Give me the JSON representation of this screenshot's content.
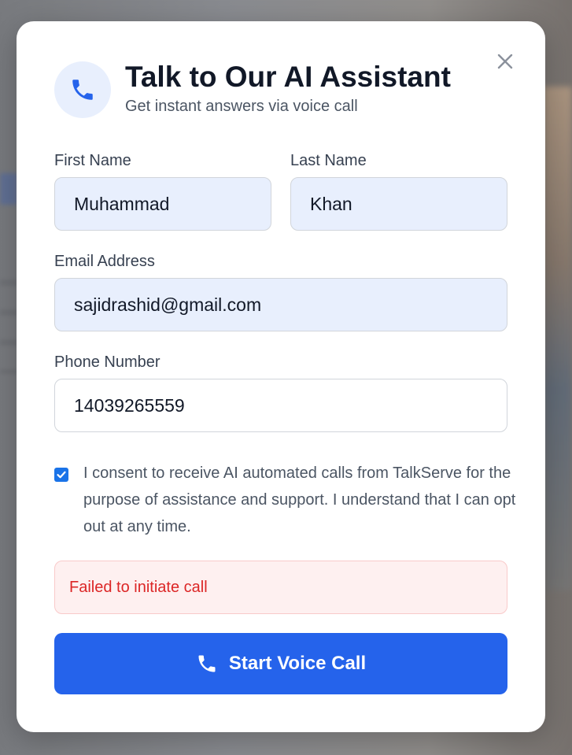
{
  "modal": {
    "title": "Talk to Our AI Assistant",
    "subtitle": "Get instant answers via voice call",
    "icon": "phone-icon",
    "close_icon": "close-icon"
  },
  "form": {
    "first_name": {
      "label": "First Name",
      "value": "Muhammad"
    },
    "last_name": {
      "label": "Last Name",
      "value": "Khan"
    },
    "email": {
      "label": "Email Address",
      "value": "sajidrashid@gmail.com"
    },
    "phone": {
      "label": "Phone Number",
      "value": "14039265559"
    },
    "consent": {
      "checked": true,
      "text": "I consent to receive AI automated calls from TalkServe for the purpose of assistance and support. I understand that I can opt out at any time."
    }
  },
  "error": {
    "message": "Failed to initiate call"
  },
  "submit": {
    "label": "Start Voice Call",
    "icon": "phone-icon"
  },
  "colors": {
    "accent": "#2563eb",
    "input_filled_bg": "#e8effd",
    "error_text": "#dc2626",
    "error_bg": "#fef0f0"
  }
}
